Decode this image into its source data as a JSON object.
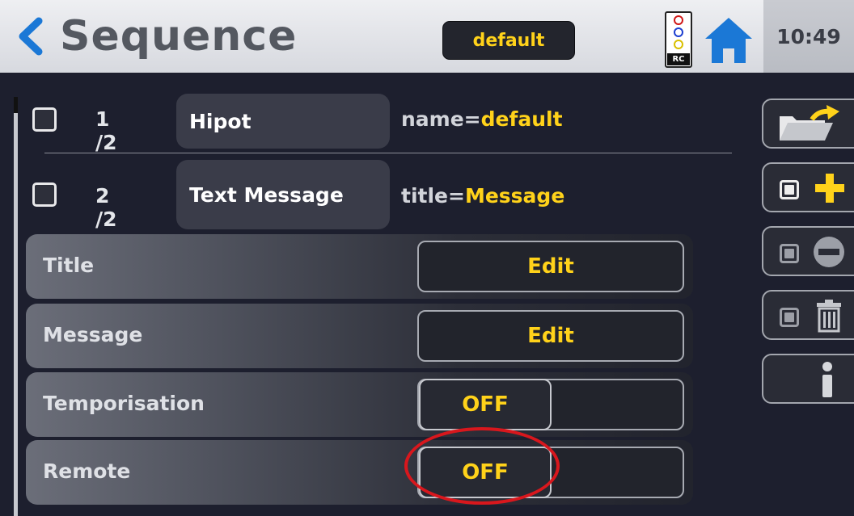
{
  "header": {
    "title": "Sequence",
    "config_name": "default",
    "remote_indicator": "RC",
    "time": "10:49"
  },
  "steps": [
    {
      "index": "1 /2",
      "name": "Hipot",
      "param_key": "name=",
      "param_value": "default"
    },
    {
      "index": "2 /2",
      "name": "Text Message",
      "param_key": "title=",
      "param_value": "Message"
    }
  ],
  "params": [
    {
      "label": "Title",
      "control": "Edit"
    },
    {
      "label": "Message",
      "control": "Edit"
    },
    {
      "label": "Temporisation",
      "control": "OFF"
    },
    {
      "label": "Remote",
      "control": "OFF"
    }
  ],
  "tools": [
    "open-folder-icon",
    "add-icon",
    "remove-icon",
    "trash-icon",
    "info-icon"
  ],
  "colors": {
    "accent": "#ffd21a",
    "highlight": "#d8171d",
    "back_arrow": "#1b78d6"
  }
}
